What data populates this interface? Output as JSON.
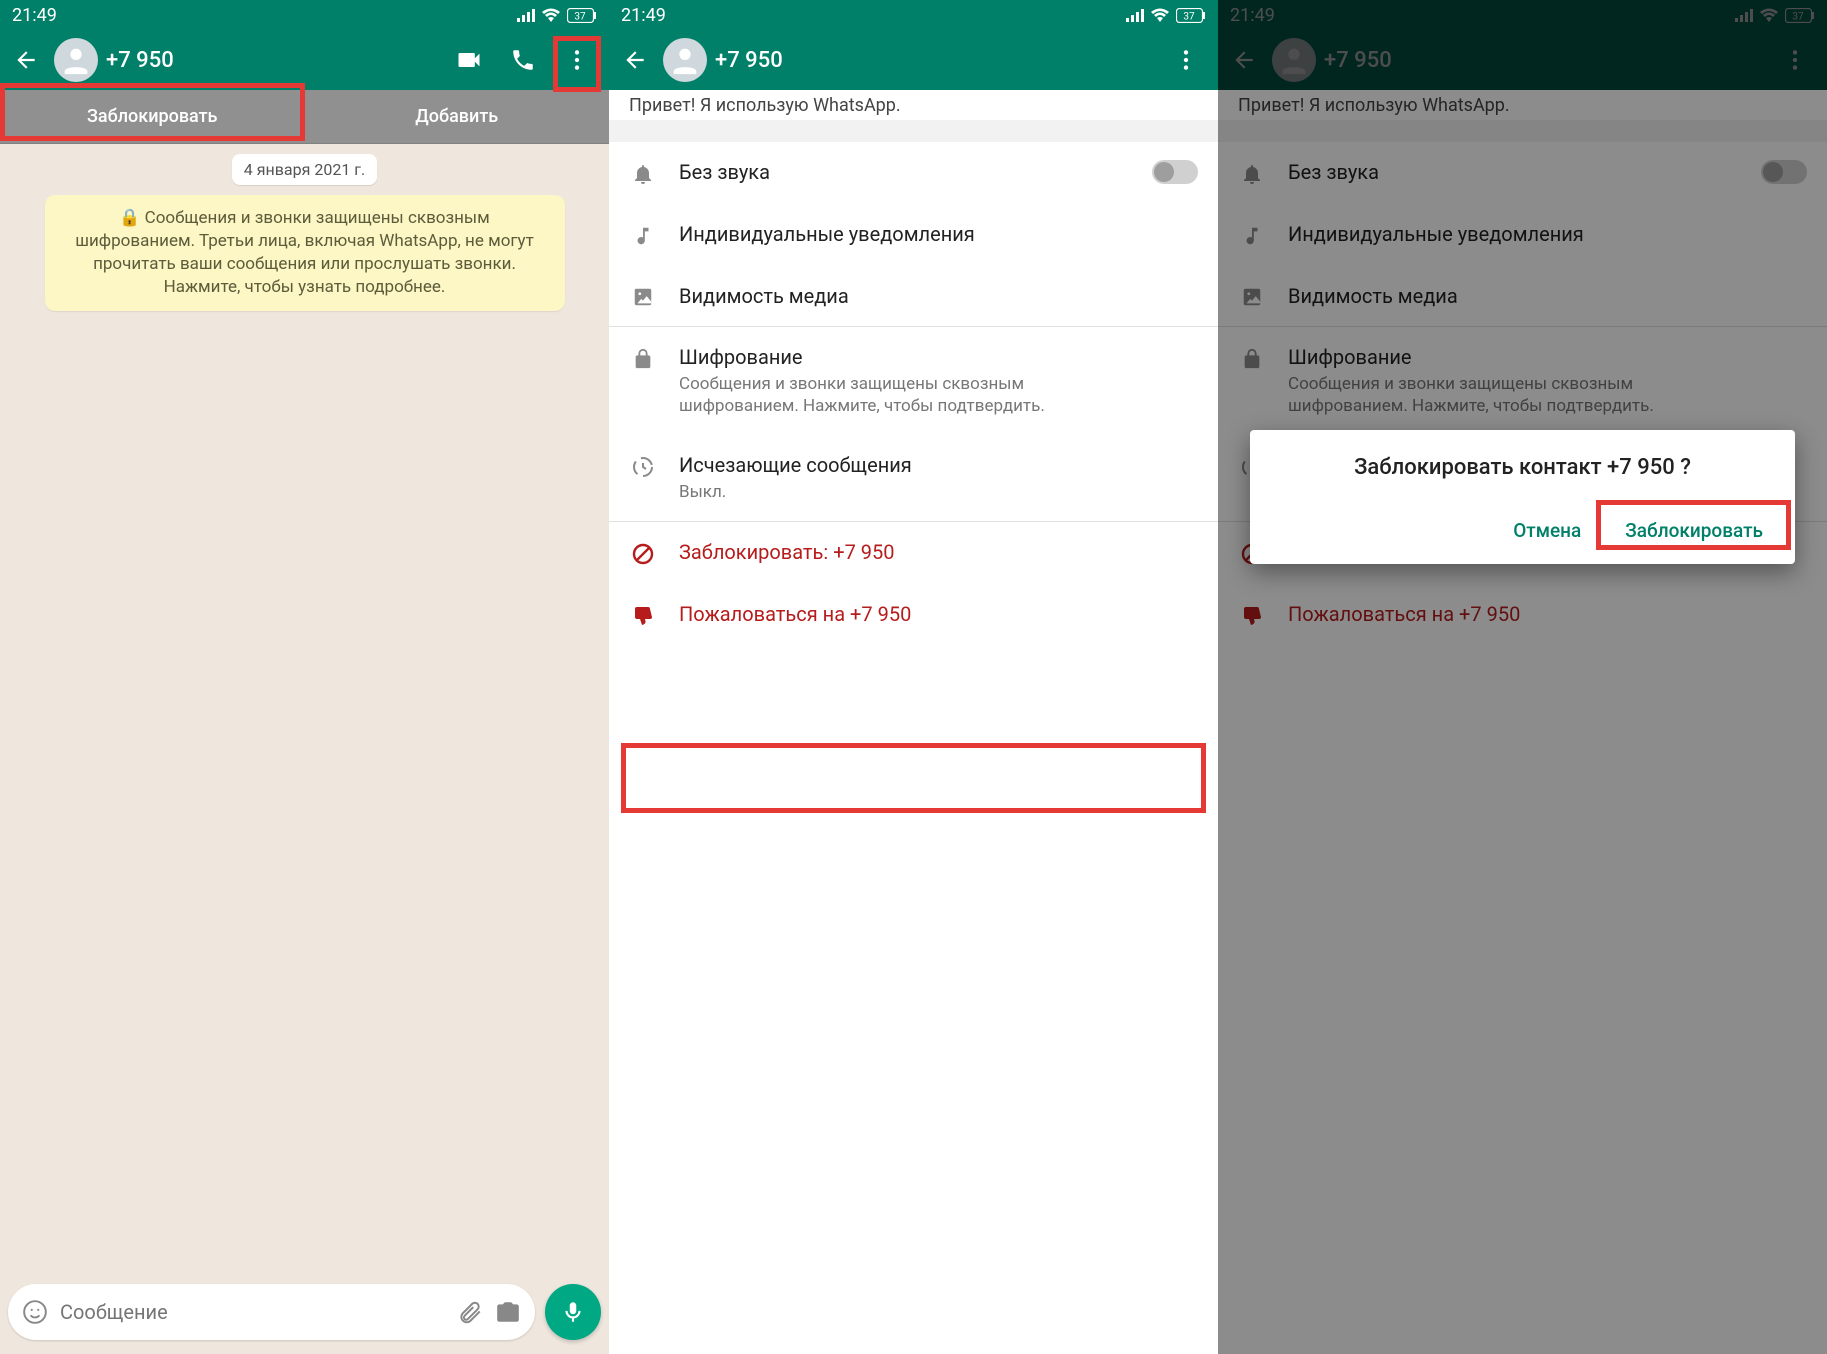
{
  "status": {
    "time": "21:49",
    "battery": "37"
  },
  "contact": {
    "number": "+7 950"
  },
  "phone1": {
    "tab_block": "Заблокировать",
    "tab_add": "Добавить",
    "date_chip": "4 января 2021 г.",
    "encryption_notice": "🔒 Сообщения и звонки защищены сквозным шифрованием. Третьи лица, включая WhatsApp, не могут прочитать ваши сообщения или прослушать звонки. Нажмите, чтобы узнать подробнее.",
    "input_placeholder": "Сообщение"
  },
  "settings": {
    "partial_top": "Привет! Я использую WhatsApp.",
    "mute": "Без звука",
    "custom_notif": "Индивидуальные уведомления",
    "media_vis": "Видимость медиа",
    "encryption": "Шифрование",
    "encryption_sub": "Сообщения и звонки защищены сквозным шифрованием. Нажмите, чтобы подтвердить.",
    "disappearing": "Исчезающие сообщения",
    "disappearing_sub": "Выкл.",
    "block": "Заблокировать: +7 950",
    "report": "Пожаловаться на +7 950"
  },
  "dialog": {
    "title": "Заблокировать контакт +7 950 ?",
    "cancel": "Отмена",
    "confirm": "Заблокировать"
  }
}
